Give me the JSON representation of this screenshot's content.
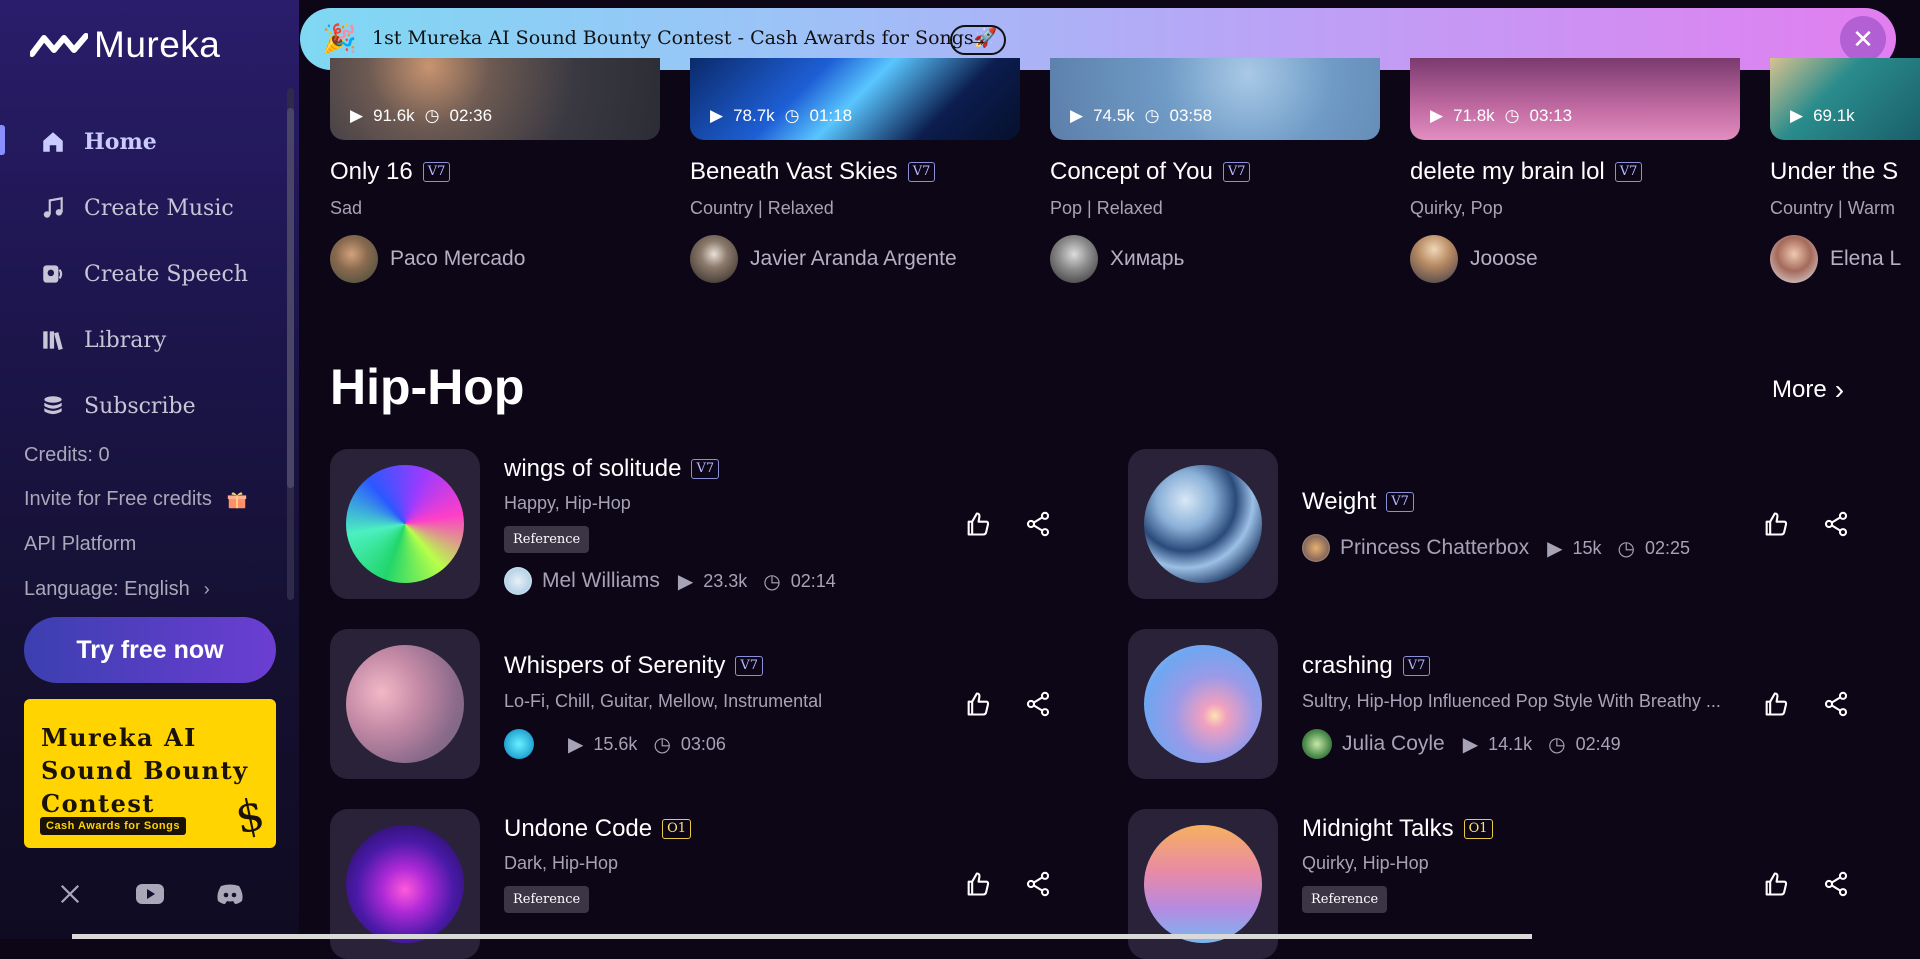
{
  "sidebar": {
    "logo": "Mureka",
    "nav": [
      {
        "label": "Home"
      },
      {
        "label": "Create Music"
      },
      {
        "label": "Create Speech"
      },
      {
        "label": "Library"
      },
      {
        "label": "Subscribe"
      }
    ],
    "credits": "Credits: 0",
    "invite": "Invite for Free credits",
    "api": "API Platform",
    "language": "Language: English",
    "try_btn": "Try free now",
    "contest": {
      "line1": "Mureka AI",
      "line2": "Sound Bounty",
      "line3": "Contest",
      "sub": "Cash Awards for Songs"
    }
  },
  "banner": {
    "text": "1st Mureka AI Sound Bounty Contest - Cash Awards for Songs🚀"
  },
  "top_cards": [
    {
      "plays": "91.6k",
      "duration": "02:36",
      "title": "Only 16",
      "tag": "V7",
      "genre": "Sad",
      "artist": "Paco Mercado"
    },
    {
      "plays": "78.7k",
      "duration": "01:18",
      "title": "Beneath Vast Skies",
      "tag": "V7",
      "genre": "Country | Relaxed",
      "artist": "Javier Aranda Argente"
    },
    {
      "plays": "74.5k",
      "duration": "03:58",
      "title": "Concept of You",
      "tag": "V7",
      "genre": "Pop | Relaxed",
      "artist": "Химарь"
    },
    {
      "plays": "71.8k",
      "duration": "03:13",
      "title": "delete my brain lol",
      "tag": "V7",
      "genre": "Quirky, Pop",
      "artist": "Jooose"
    },
    {
      "plays": "69.1k",
      "duration": "",
      "title": "Under the S",
      "tag": "",
      "genre": "Country | Warm",
      "artist": "Elena L"
    }
  ],
  "section": {
    "title": "Hip-Hop",
    "more": "More"
  },
  "songs": [
    {
      "title": "wings of solitude",
      "tag": "V7",
      "genre": "Happy, Hip-Hop",
      "ref": "Reference",
      "artist": "Mel Williams",
      "plays": "23.3k",
      "duration": "02:14"
    },
    {
      "title": "Weight",
      "tag": "V7",
      "genre": "",
      "ref": "",
      "artist": "Princess Chatterbox",
      "plays": "15k",
      "duration": "02:25"
    },
    {
      "title": "Whispers of Serenity",
      "tag": "V7",
      "genre": "Lo-Fi, Chill, Guitar, Mellow, Instrumental",
      "ref": "",
      "artist": "",
      "plays": "15.6k",
      "duration": "03:06"
    },
    {
      "title": "crashing",
      "tag": "V7",
      "genre": "Sultry, Hip-Hop Influenced Pop Style With Breathy ...",
      "ref": "",
      "artist": "Julia Coyle",
      "plays": "14.1k",
      "duration": "02:49"
    },
    {
      "title": "Undone Code",
      "tag": "O1",
      "genre": "Dark, Hip-Hop",
      "ref": "Reference",
      "artist": "",
      "plays": "",
      "duration": ""
    },
    {
      "title": "Midnight Talks",
      "tag": "O1",
      "genre": "Quirky, Hip-Hop",
      "ref": "Reference",
      "artist": "",
      "plays": "",
      "duration": ""
    }
  ]
}
